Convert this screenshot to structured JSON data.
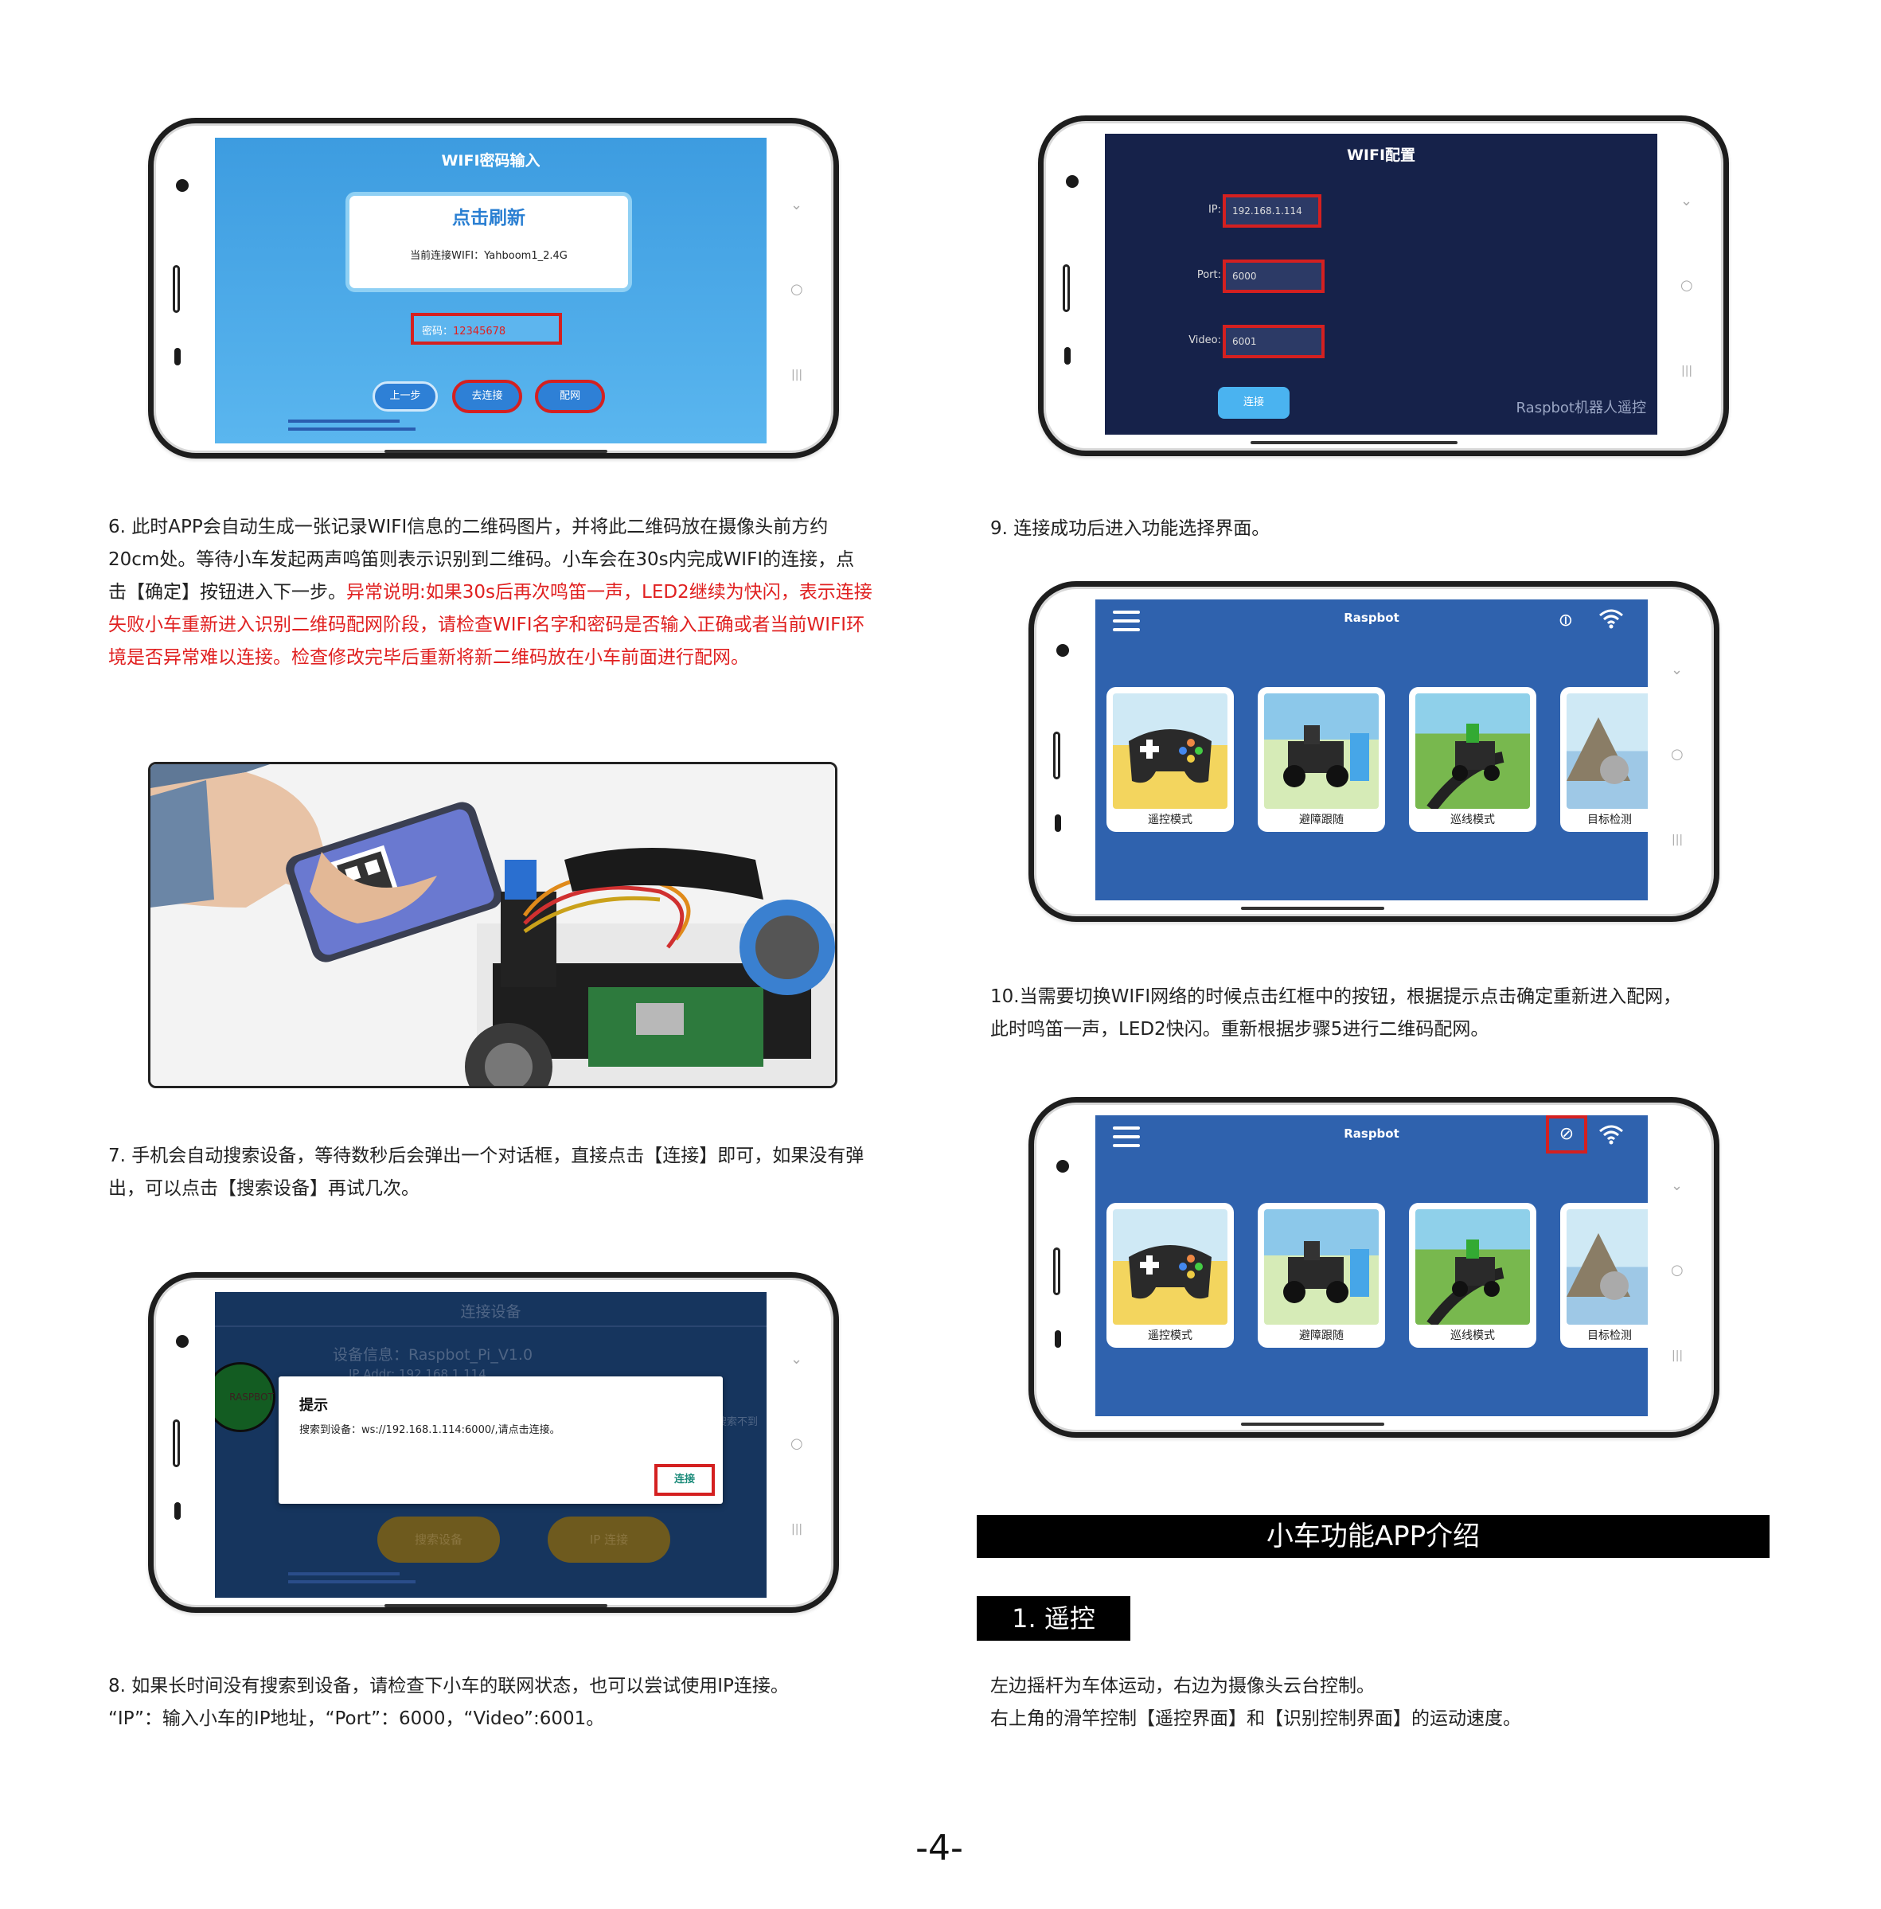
{
  "screen1": {
    "title": "WIFI密码输入",
    "refresh_label": "点击刷新",
    "current_wifi": "当前连接WIFI：Yahboom1_2.4G",
    "password_label": "密码：",
    "password_value": "12345678",
    "btn_prev": "上一步",
    "btn_connect": "去连接",
    "btn_config": "配网"
  },
  "screen2": {
    "title": "WIFI配置",
    "ip_label": "IP:",
    "ip_value": "192.168.1.114",
    "port_label": "Port:",
    "port_value": "6000",
    "video_label": "Video:",
    "video_value": "6001",
    "connect_btn": "连接",
    "watermark": "Raspbot机器人遥控"
  },
  "step6": {
    "text": "6. 此时APP会自动生成一张记录WIFI信息的二维码图片，并将此二维码放在摄像头前方约20cm处。等待小车发起两声鸣笛则表示识别到二维码。小车会在30s内完成WIFI的连接，点击【确定】按钮进入下一步。",
    "note": "异常说明:如果30s后再次鸣笛一声，LED2继续为快闪，表示连接失败小车重新进入识别二维码配网阶段，请检查WIFI名字和密码是否输入正确或者当前WIFI环境是否异常难以连接。检查修改完毕后重新将新二维码放在小车前面进行配网。"
  },
  "step7": {
    "text": "7. 手机会自动搜索设备，等待数秒后会弹出一个对话框，直接点击【连接】即可，如果没有弹出，可以点击【搜索设备】再试几次。"
  },
  "step8": {
    "line1": "8. 如果长时间没有搜索到设备，请检查下小车的联网状态，也可以尝试使用IP连接。",
    "line2": "“IP”：输入小车的IP地址，“Port”：6000，“Video”:6001。"
  },
  "step9": {
    "text": "9. 连接成功后进入功能选择界面。"
  },
  "step10": {
    "line1": "10.当需要切换WIFI网络的时候点击红框中的按钮，根据提示点击确定重新进入配网，",
    "line2": "此时鸣笛一声，LED2快闪。重新根据步骤5进行二维码配网。"
  },
  "screen3": {
    "title": "连接设备",
    "device_info": "设备信息：Raspbot_Pi_V1.0",
    "ip_addr": "IP Addr: 192.168.1.114",
    "logo_text": "RASPBOT",
    "right_hint": "搜索不到",
    "dialog_title": "提示",
    "dialog_msg": "搜索到设备：ws://192.168.1.114:6000/,请点击连接。",
    "dialog_btn": "连接",
    "btn_search": "搜索设备",
    "btn_ip": "IP 连接"
  },
  "app": {
    "title": "Raspbot",
    "cards": [
      "遥控模式",
      "避障跟随",
      "巡线模式",
      "目标检测"
    ]
  },
  "section": {
    "title": "小车功能APP介绍",
    "sub": "1. 遥控",
    "desc1": "左边摇杆为车体运动，右边为摄像头云台控制。",
    "desc2": "右上角的滑竿控制【遥控界面】和【识别控制界面】的运动速度。"
  },
  "page_number": "-4-",
  "colors": {
    "app_blue": "#2f62ae",
    "dark_navy": "#16224a",
    "light_blue": "#4ea6e6",
    "red": "#d42020",
    "brown": "#6e5a1e"
  }
}
